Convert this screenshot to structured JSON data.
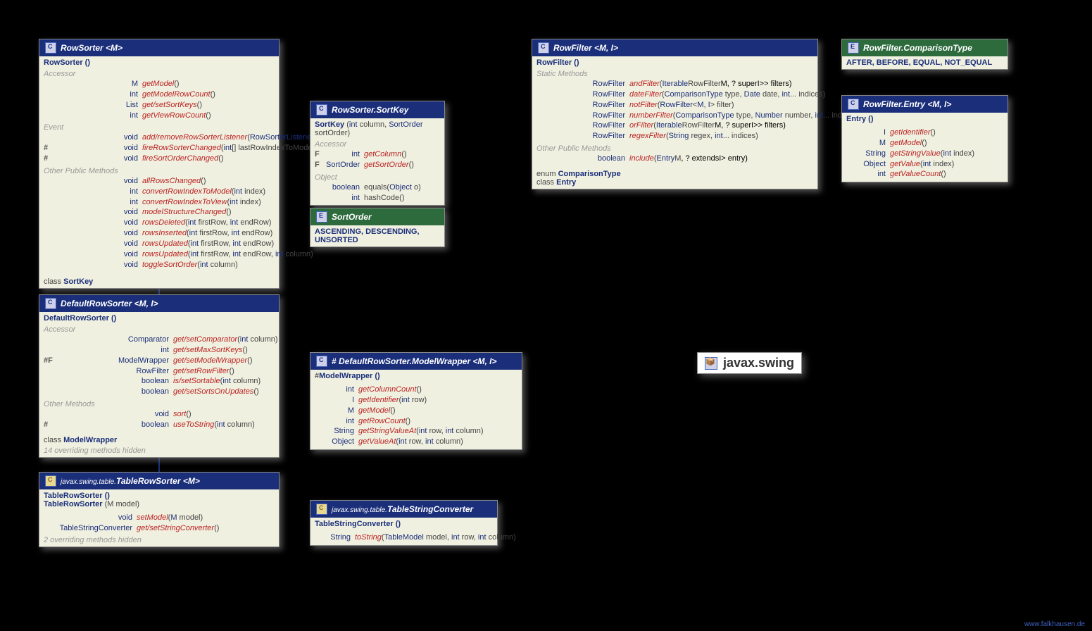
{
  "pkg": "javax.swing",
  "footer": "www.falkhausen.de",
  "RowSorter": {
    "title": "RowSorter <M>",
    "ctor": "RowSorter ()",
    "acc": [
      {
        "ret": "M",
        "m": "getModel",
        "p": "()"
      },
      {
        "ret": "int",
        "m": "getModelRowCount",
        "p": "()"
      },
      {
        "ret": "List<? extends SortKey>",
        "m": "get/setSortKeys",
        "p": "()"
      },
      {
        "ret": "int",
        "m": "getViewRowCount",
        "p": "()"
      }
    ],
    "ev": [
      {
        "ret": "void",
        "m": "add/removeRowSorterListener",
        "p": "(RowSorterListener l)"
      },
      {
        "pre": "#",
        "ret": "void",
        "m": "fireRowSorterChanged",
        "p": "(int[] lastRowIndexToModel)"
      },
      {
        "pre": "#",
        "ret": "void",
        "m": "fireSortOrderChanged",
        "p": "()"
      }
    ],
    "pub": [
      {
        "ret": "void",
        "m": "allRowsChanged",
        "p": "()"
      },
      {
        "ret": "int",
        "m": "convertRowIndexToModel",
        "p": "(int index)"
      },
      {
        "ret": "int",
        "m": "convertRowIndexToView",
        "p": "(int index)"
      },
      {
        "ret": "void",
        "m": "modelStructureChanged",
        "p": "()"
      },
      {
        "ret": "void",
        "m": "rowsDeleted",
        "p": "(int firstRow, int endRow)"
      },
      {
        "ret": "void",
        "m": "rowsInserted",
        "p": "(int firstRow, int endRow)"
      },
      {
        "ret": "void",
        "m": "rowsUpdated",
        "p": "(int firstRow, int endRow)"
      },
      {
        "ret": "void",
        "m": "rowsUpdated",
        "p": "(int firstRow, int endRow, int column)"
      },
      {
        "ret": "void",
        "m": "toggleSortOrder",
        "p": "(int column)"
      }
    ],
    "nest": "class SortKey"
  },
  "SortKey": {
    "title": "RowSorter.SortKey",
    "ctor": "SortKey (int column, SortOrder sortOrder)",
    "acc": [
      {
        "pre": "F",
        "ret": "int",
        "m": "getColumn",
        "p": "()"
      },
      {
        "pre": "F",
        "ret": "SortOrder",
        "m": "getSortOrder",
        "p": "()"
      }
    ],
    "obj": [
      {
        "ret": "boolean",
        "m": "equals",
        "p": "(Object o)",
        "plain": true
      },
      {
        "ret": "int",
        "m": "hashCode",
        "p": "()",
        "plain": true
      }
    ]
  },
  "SortOrder": {
    "title": "SortOrder",
    "vals": "ASCENDING, DESCENDING, UNSORTED"
  },
  "DefaultRowSorter": {
    "title": "DefaultRowSorter <M, I>",
    "ctor": "DefaultRowSorter ()",
    "acc": [
      {
        "ret": "Comparator<?>",
        "m": "get/setComparator",
        "p": "(int column)"
      },
      {
        "ret": "int",
        "m": "get/setMaxSortKeys",
        "p": "()"
      },
      {
        "pre": "#F",
        "ret": "ModelWrapper<M, I>",
        "m": "get/setModelWrapper",
        "p": "()"
      },
      {
        "ret": "RowFilter<? super M, ? super I>",
        "m": "get/setRowFilter",
        "p": "()"
      },
      {
        "ret": "boolean",
        "m": "is/setSortable",
        "p": "(int column)"
      },
      {
        "ret": "boolean",
        "m": "get/setSortsOnUpdates",
        "p": "()"
      }
    ],
    "oth": [
      {
        "ret": "void",
        "m": "sort",
        "p": "()"
      },
      {
        "pre": "#",
        "ret": "boolean",
        "m": "useToString",
        "p": "(int column)"
      }
    ],
    "nest": "class ModelWrapper",
    "foot": "14 overriding methods hidden"
  },
  "ModelWrapper": {
    "title": "# DefaultRowSorter.ModelWrapper <M, I>",
    "ctor": "#ModelWrapper ()",
    "m": [
      {
        "ret": "int",
        "m": "getColumnCount",
        "p": "()"
      },
      {
        "ret": "I",
        "m": "getIdentifier",
        "p": "(int row)"
      },
      {
        "ret": "M",
        "m": "getModel",
        "p": "()"
      },
      {
        "ret": "int",
        "m": "getRowCount",
        "p": "()"
      },
      {
        "ret": "String",
        "m": "getStringValueAt",
        "p": "(int row, int column)"
      },
      {
        "ret": "Object",
        "m": "getValueAt",
        "p": "(int row, int column)"
      }
    ]
  },
  "TableRowSorter": {
    "title": "javax.swing.table.TableRowSorter <M>",
    "ctors": [
      "TableRowSorter ()",
      "TableRowSorter (M model)"
    ],
    "m": [
      {
        "ret": "void",
        "m": "setModel",
        "p": "(M model)"
      },
      {
        "ret": "TableStringConverter",
        "m": "get/setStringConverter",
        "p": "()"
      }
    ],
    "foot": "2 overriding methods hidden"
  },
  "TableStringConverter": {
    "title": "javax.swing.table.TableStringConverter",
    "ctor": "TableStringConverter ()",
    "m": [
      {
        "ret": "String",
        "m": "toString",
        "p": "(TableModel model, int row, int column)"
      }
    ]
  },
  "RowFilter": {
    "title": "RowFilter <M, I>",
    "ctor": "RowFilter ()",
    "stat": [
      {
        "ret": "<M, I> RowFilter<M, I>",
        "m": "andFilter",
        "p": "(Iterable<? extends RowFilter<? super M, ? super I>> filters)"
      },
      {
        "ret": "<M, I> RowFilter<M, I>",
        "m": "dateFilter",
        "p": "(ComparisonType type, Date date, int... indices)"
      },
      {
        "ret": "<M, I> RowFilter<M, I>",
        "m": "notFilter",
        "p": "(RowFilter<M, I> filter)"
      },
      {
        "ret": "<M, I> RowFilter<M, I>",
        "m": "numberFilter",
        "p": "(ComparisonType type, Number number, int... indices)"
      },
      {
        "ret": "<M, I> RowFilter<M, I>",
        "m": "orFilter",
        "p": "(Iterable<? extends RowFilter<? super M, ? super I>> filters)"
      },
      {
        "ret": "<M, I> RowFilter<M, I>",
        "m": "regexFilter",
        "p": "(String regex, int... indices)"
      }
    ],
    "pub": [
      {
        "ret": "boolean",
        "m": "include",
        "p": "(Entry<? extends M, ? extends I> entry)"
      }
    ],
    "nest": [
      "enum ComparisonType",
      "class Entry"
    ]
  },
  "ComparisonType": {
    "title": "RowFilter.ComparisonType",
    "vals": "AFTER, BEFORE, EQUAL, NOT_EQUAL"
  },
  "Entry": {
    "title": "RowFilter.Entry <M, I>",
    "ctor": "Entry ()",
    "m": [
      {
        "ret": "I",
        "m": "getIdentifier",
        "p": "()"
      },
      {
        "ret": "M",
        "m": "getModel",
        "p": "()"
      },
      {
        "ret": "String",
        "m": "getStringValue",
        "p": "(int index)"
      },
      {
        "ret": "Object",
        "m": "getValue",
        "p": "(int index)"
      },
      {
        "ret": "int",
        "m": "getValueCount",
        "p": "()"
      }
    ]
  }
}
